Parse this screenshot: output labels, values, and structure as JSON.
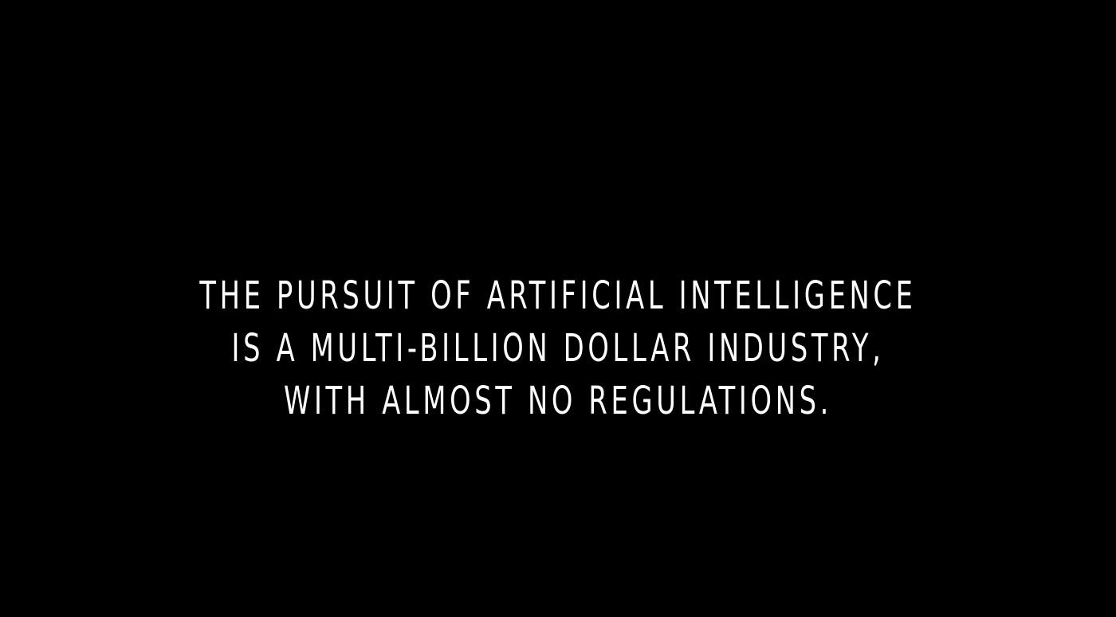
{
  "caption": {
    "lines": [
      "THE PURSUIT OF ARTIFICIAL INTELLIGENCE",
      "IS A MULTI-BILLION DOLLAR INDUSTRY,",
      "WITH ALMOST NO REGULATIONS."
    ]
  },
  "colors": {
    "background": "#000000",
    "text": "#ffffff"
  }
}
